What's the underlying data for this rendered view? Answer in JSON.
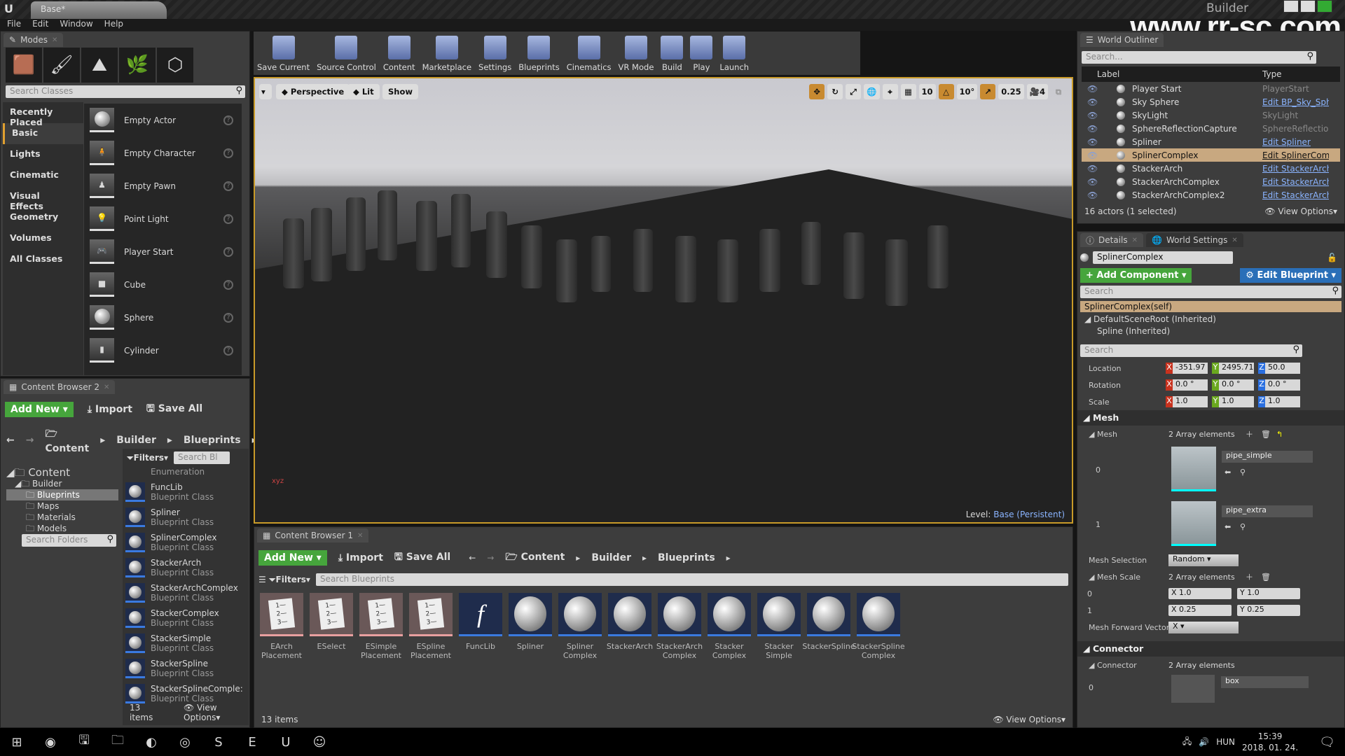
{
  "window": {
    "doc_tab": "Base*",
    "project": "Builder",
    "watermark": "www.rr-sc.com"
  },
  "menu": [
    "File",
    "Edit",
    "Window",
    "Help"
  ],
  "modes": {
    "tab": "Modes",
    "search_placeholder": "Search Classes",
    "categories": [
      "Recently Placed",
      "Basic",
      "Lights",
      "Cinematic",
      "Visual Effects",
      "Geometry",
      "Volumes",
      "All Classes"
    ],
    "selected_category": "Basic",
    "items": [
      "Empty Actor",
      "Empty Character",
      "Empty Pawn",
      "Point Light",
      "Player Start",
      "Cube",
      "Sphere",
      "Cylinder"
    ]
  },
  "toolbar": [
    "Save Current",
    "Source Control",
    "Content",
    "Marketplace",
    "Settings",
    "Blueprints",
    "Cinematics",
    "VR Mode",
    "Build",
    "Play",
    "Launch"
  ],
  "viewport": {
    "perspective": "Perspective",
    "lit": "Lit",
    "show": "Show",
    "grid": "10",
    "angle": "10°",
    "scale": "0.25",
    "camera_speed": "4",
    "level_label": "Level:",
    "level_name": "Base (Persistent)"
  },
  "cb2": {
    "tab": "Content Browser 2",
    "add_new": "Add New",
    "import": "Import",
    "save_all": "Save All",
    "path": [
      "Content",
      "Builder",
      "Blueprints"
    ],
    "search_folders": "Search Folders",
    "filters": "Filters",
    "search_placeholder": "Search Bl",
    "tree": [
      "Content",
      "Builder",
      "Blueprints",
      "Maps",
      "Materials",
      "Models"
    ],
    "partial_item": {
      "name": "",
      "type": "Enumeration"
    },
    "items": [
      {
        "name": "FuncLib",
        "type": "Blueprint Class"
      },
      {
        "name": "Spliner",
        "type": "Blueprint Class"
      },
      {
        "name": "SplinerComplex",
        "type": "Blueprint Class"
      },
      {
        "name": "StackerArch",
        "type": "Blueprint Class"
      },
      {
        "name": "StackerArchComplex",
        "type": "Blueprint Class"
      },
      {
        "name": "StackerComplex",
        "type": "Blueprint Class"
      },
      {
        "name": "StackerSimple",
        "type": "Blueprint Class"
      },
      {
        "name": "StackerSpline",
        "type": "Blueprint Class"
      },
      {
        "name": "StackerSplineComple:",
        "type": "Blueprint Class"
      }
    ],
    "count": "13 items",
    "view_options": "View Options"
  },
  "cb1": {
    "tab": "Content Browser 1",
    "add_new": "Add New",
    "import": "Import",
    "save_all": "Save All",
    "path": [
      "Content",
      "Builder",
      "Blueprints"
    ],
    "filters": "Filters",
    "search_placeholder": "Search Blueprints",
    "assets": [
      {
        "l1": "EArch",
        "l2": "Placement",
        "kind": "enum"
      },
      {
        "l1": "ESelect",
        "l2": "",
        "kind": "enum"
      },
      {
        "l1": "ESimple",
        "l2": "Placement",
        "kind": "enum"
      },
      {
        "l1": "ESpline",
        "l2": "Placement",
        "kind": "enum"
      },
      {
        "l1": "FuncLib",
        "l2": "",
        "kind": "func"
      },
      {
        "l1": "Spliner",
        "l2": "",
        "kind": "bp"
      },
      {
        "l1": "Spliner",
        "l2": "Complex",
        "kind": "bp"
      },
      {
        "l1": "StackerArch",
        "l2": "",
        "kind": "bp"
      },
      {
        "l1": "StackerArch",
        "l2": "Complex",
        "kind": "bp"
      },
      {
        "l1": "Stacker",
        "l2": "Complex",
        "kind": "bp"
      },
      {
        "l1": "Stacker",
        "l2": "Simple",
        "kind": "bp"
      },
      {
        "l1": "StackerSpline",
        "l2": "",
        "kind": "bp"
      },
      {
        "l1": "StackerSpline",
        "l2": "Complex",
        "kind": "bp"
      }
    ],
    "count": "13 items",
    "view_options": "View Options"
  },
  "outliner": {
    "tab": "World Outliner",
    "search_placeholder": "Search...",
    "col_label": "Label",
    "col_type": "Type",
    "rows": [
      {
        "label": "Player Start",
        "type": "PlayerStart",
        "link": false
      },
      {
        "label": "Sky Sphere",
        "type": "Edit BP_Sky_Sph",
        "link": true
      },
      {
        "label": "SkyLight",
        "type": "SkyLight",
        "link": false
      },
      {
        "label": "SphereReflectionCapture",
        "type": "SphereReflectionC",
        "link": false
      },
      {
        "label": "Spliner",
        "type": "Edit Spliner",
        "link": true
      },
      {
        "label": "SplinerComplex",
        "type": "Edit SplinerComp",
        "link": true,
        "selected": true
      },
      {
        "label": "StackerArch",
        "type": "Edit StackerArch",
        "link": true
      },
      {
        "label": "StackerArchComplex",
        "type": "Edit StackerArch",
        "link": true
      },
      {
        "label": "StackerArchComplex2",
        "type": "Edit StackerArch",
        "link": true
      }
    ],
    "status": "16 actors (1 selected)",
    "view_options": "View Options"
  },
  "details": {
    "tab": "Details",
    "tab2": "World Settings",
    "actor_name": "SplinerComplex",
    "add_component": "Add Component",
    "edit_blueprint": "Edit Blueprint",
    "search_placeholder": "Search",
    "components": [
      "SplinerComplex(self)",
      "DefaultSceneRoot (Inherited)",
      "Spline (Inherited)"
    ],
    "transform": [
      {
        "name": "Location",
        "x": "-351.97",
        "y": "2495.71",
        "z": "50.0"
      },
      {
        "name": "Rotation",
        "x": "0.0 °",
        "y": "0.0 °",
        "z": "0.0 °"
      },
      {
        "name": "Scale",
        "x": "1.0",
        "y": "1.0",
        "z": "1.0"
      }
    ],
    "mesh_section": "Mesh",
    "mesh_label": "Mesh",
    "array_text": "2 Array elements",
    "meshes": [
      {
        "index": "0",
        "name": "pipe_simple"
      },
      {
        "index": "1",
        "name": "pipe_extra"
      }
    ],
    "mesh_selection_label": "Mesh Selection",
    "mesh_selection": "Random",
    "mesh_scale_label": "Mesh Scale",
    "mesh_scales": [
      {
        "index": "0",
        "x": "1.0",
        "y": "1.0"
      },
      {
        "index": "1",
        "x": "0.25",
        "y": "0.25"
      }
    ],
    "forward_label": "Mesh Forward Vector",
    "forward": "X",
    "connector_section": "Connector",
    "connector_label": "Connector",
    "connector_item": {
      "index": "0",
      "name": "box"
    }
  },
  "taskbar": {
    "lang": "HUN",
    "time": "15:39",
    "date": "2018. 01. 24."
  },
  "colors": {
    "accent": "#c89a28",
    "green": "#46a53c",
    "blue": "#2a6fb8",
    "selection": "#c8a880"
  }
}
